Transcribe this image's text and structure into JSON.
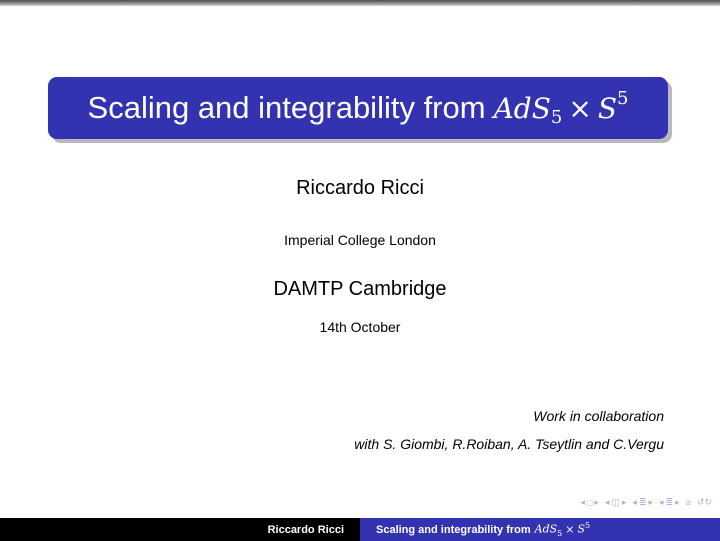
{
  "slide": {
    "title": {
      "text": "Scaling and integrability from",
      "math_base1": "AdS",
      "math_sub": "5",
      "math_op": "×",
      "math_base2": "S",
      "math_sup": "5"
    },
    "author": "Riccardo Ricci",
    "institute": "Imperial College London",
    "venue": "DAMTP Cambridge",
    "date": "14th October",
    "collaboration": {
      "line1": "Work in collaboration",
      "line2": "with S. Giombi, R.Roiban, A. Tseytlin and C.Vergu"
    }
  },
  "navigation": {
    "icons": [
      "nav-left-icon",
      "frame-icon",
      "nav-right-icon",
      "nav-left-icon",
      "subsection-icon",
      "nav-right-icon",
      "nav-left-icon",
      "section-icon",
      "nav-right-icon",
      "nav-left-icon",
      "section-icon",
      "nav-right-icon",
      "align-icon",
      "search-icon"
    ],
    "symbols": {
      "left": "◂",
      "right": "▸",
      "frame": "□",
      "subsection": "◫",
      "section": "≣",
      "align": "≡",
      "search": "↺↻"
    }
  },
  "footer": {
    "author": "Riccardo Ricci",
    "title": "Scaling and integrability from",
    "math_base1": "AdS",
    "math_sub": "5",
    "math_op": "×",
    "math_base2": "S",
    "math_sup": "5"
  },
  "colors": {
    "accent": "#3333b2",
    "footer_dark": "#000000",
    "nav": "#b2b2d8"
  }
}
